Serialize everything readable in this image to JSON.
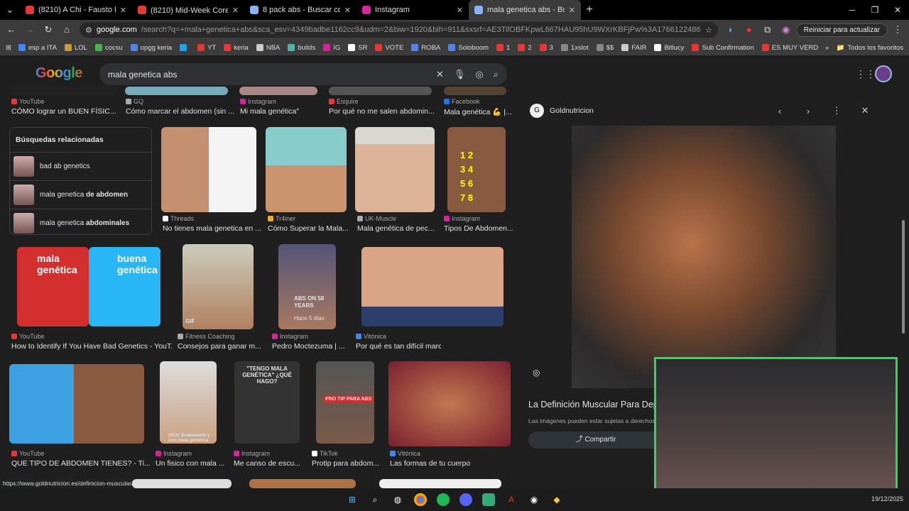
{
  "tabs": [
    {
      "title": "(8210) A Chi - Fausto Leali - Yo",
      "color": "#e53935"
    },
    {
      "title": "(8210) Mid-Week Core 🔥 Let's",
      "color": "#e53935"
    },
    {
      "title": "8 pack abs - Buscar con Google",
      "color": "#8ab4f8"
    },
    {
      "title": "Instagram",
      "color": "#d6249f"
    },
    {
      "title": "mala genetica abs - Buscar con",
      "color": "#8ab4f8"
    }
  ],
  "omnibox": {
    "host": "google.com",
    "path": "/search?q=+mala+genetica+abs&sca_esv=4349badbe1162cc9&udm=2&biw=1920&bih=911&sxsrf=AE3TifOBFKpwL667HAU95hU9WXrKBFjPw%3A1766122486728&ei=9uNEaeSSLLT21sQPhrGI-QQ&ve..."
  },
  "toolbar": {
    "relaunch": "Reiniciar para actualizar"
  },
  "bookmarks": [
    {
      "label": "esp a ITA",
      "color": "#4285f4"
    },
    {
      "label": "LOL",
      "color": "#c89b3c"
    },
    {
      "label": "cocsu",
      "color": "#4caf50"
    },
    {
      "label": "opgg keria",
      "color": "#5383e8"
    },
    {
      "label": "",
      "color": "#1da1f2"
    },
    {
      "label": "YT",
      "color": "#e53935"
    },
    {
      "label": "keria",
      "color": "#e53935"
    },
    {
      "label": "NBA",
      "color": "#ccc"
    },
    {
      "label": "builds",
      "color": "#4db6ac"
    },
    {
      "label": "IG",
      "color": "#d6249f"
    },
    {
      "label": "SR",
      "color": "#fff"
    },
    {
      "label": "VOTE",
      "color": "#e53935"
    },
    {
      "label": "ROBA",
      "color": "#5383e8"
    },
    {
      "label": "Soloboom",
      "color": "#5383e8"
    },
    {
      "label": "1",
      "color": "#e53935"
    },
    {
      "label": "2",
      "color": "#e53935"
    },
    {
      "label": "3",
      "color": "#e53935"
    },
    {
      "label": "1xslot",
      "color": "#888"
    },
    {
      "label": "$$",
      "color": "#888"
    },
    {
      "label": "FAIR",
      "color": "#ccc"
    },
    {
      "label": "Bitlucy",
      "color": "#fff"
    },
    {
      "label": "Sub Confirmation",
      "color": "#e53935"
    },
    {
      "label": "ES MUY VERDAD PE...",
      "color": "#e53935"
    }
  ],
  "bookmarks_all": "Todos los favoritos",
  "search": {
    "logo": "Google",
    "query": "mala genetica abs"
  },
  "row0": [
    {
      "src": "YouTube",
      "cap": "CÓMO lograr un BUEN FÍSIC...",
      "c": "#e53935"
    },
    {
      "src": "GQ",
      "cap": "Cómo marcar el abdomen (sin ...",
      "c": "#aaa"
    },
    {
      "src": "Instagram",
      "cap": "Mi mala genética\"",
      "c": "#d6249f"
    },
    {
      "src": "Esquire",
      "cap": "Por qué no me salen abdomin...",
      "c": "#e53935"
    },
    {
      "src": "Facebook",
      "cap": "Mala genética 💪 |...",
      "c": "#1877f2"
    }
  ],
  "related": {
    "title": "Búsquedas relacionadas",
    "items": [
      {
        "a": "bad ab genetics",
        "b": ""
      },
      {
        "a": "mala genetica ",
        "b": "de abdomen"
      },
      {
        "a": "mala genetica ",
        "b": "abdominales"
      }
    ]
  },
  "row1": [
    {
      "src": "Threads",
      "cap": "No tienes mala genetica en ...",
      "c": "#fff"
    },
    {
      "src": "Tr4iner",
      "cap": "Cómo Superar la Mala...",
      "c": "#f9a825"
    },
    {
      "src": "UK-Muscle",
      "cap": "Mala genética de pec...",
      "c": "#aaa"
    },
    {
      "src": "Instagram",
      "cap": "Tipos De Abdomen...",
      "c": "#d6249f"
    }
  ],
  "row2": [
    {
      "src": "YouTube",
      "cap": "How to Identify If You Have Bad Genetics - YouT...",
      "c": "#e53935"
    },
    {
      "src": "Fitness Coaching",
      "cap": "Consejos para ganar m...",
      "c": "#aaa"
    },
    {
      "src": "Instagram",
      "cap": "Pedro Moctezuma | ...",
      "c": "#d6249f"
    },
    {
      "src": "Vitónica",
      "cap": "Por qué es tan difícil marcar los abdominales?",
      "c": "#4285f4"
    }
  ],
  "row2_overlays": {
    "mala": "mala genética",
    "buena": "buena genética",
    "gif": "GIF",
    "abs": "ABS ON 58 YEARS",
    "hace": "Hace 5 días"
  },
  "row3": [
    {
      "src": "YouTube",
      "cap": "QUE TIPO DE ABDOMEN TIENES? - Ti...",
      "c": "#e53935"
    },
    {
      "src": "Instagram",
      "cap": "Un fisico con mala ...",
      "c": "#d6249f"
    },
    {
      "src": "Instagram",
      "cap": "Me canso de escu...",
      "c": "#d6249f"
    },
    {
      "src": "TikTok",
      "cap": "Protip para abdom...",
      "c": "#fff"
    },
    {
      "src": "Vitónica",
      "cap": "Las formas de tu cuerpo",
      "c": "#4285f4"
    }
  ],
  "row3_overlays": {
    "tengo": "\"TENGO MALA GENÉTICA\" ¿QUÉ HAGO?",
    "protip": "PRO TIP PARA ABS",
    "endo": "2019: Endomorfo y con mala genética"
  },
  "panel": {
    "source": "Goldnutricion",
    "title": "La Definición Muscular Para Depo",
    "note": "Las imágenes pueden estar sujetas a derechos d",
    "share": "Compartir"
  },
  "status_url": "https://www.goldnutricion.es/definicion-muscular/",
  "clock": {
    "time": "",
    "date": "19/12/2025"
  }
}
